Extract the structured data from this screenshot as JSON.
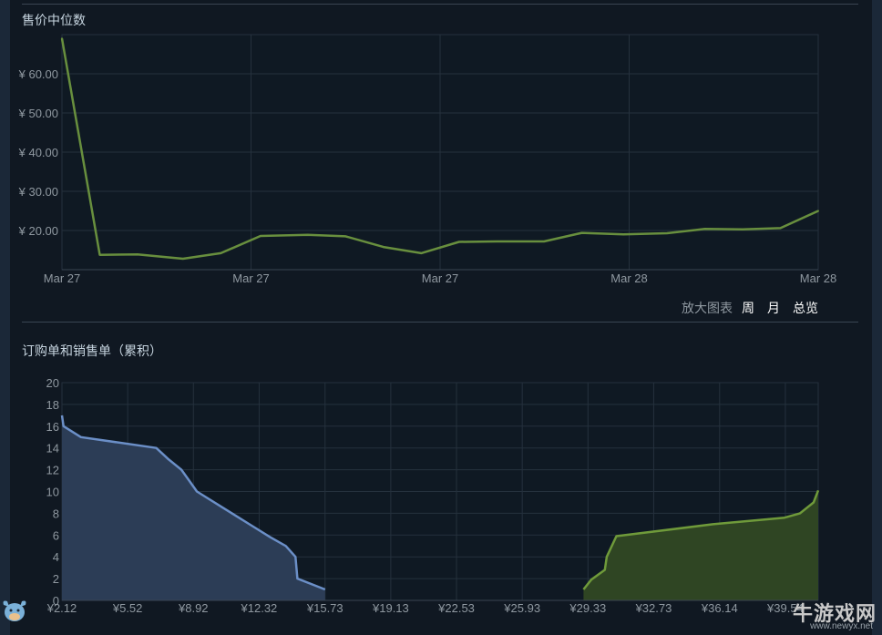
{
  "chart_data": [
    {
      "type": "line",
      "title": "售价中位数",
      "y_tick_labels": [
        "¥ 20.00",
        "¥ 30.00",
        "¥ 40.00",
        "¥ 50.00",
        "¥ 60.00"
      ],
      "y_ticks": [
        20,
        30,
        40,
        50,
        60
      ],
      "ylim": [
        10,
        70
      ],
      "x_tick_labels": [
        "Mar 27",
        "Mar 27",
        "Mar 27",
        "Mar 28",
        "Mar 28"
      ],
      "x_ticks": [
        0,
        1,
        2,
        3,
        4
      ],
      "xlim": [
        0,
        4
      ],
      "grid": true,
      "series": [
        {
          "color": "#688f3e",
          "points": [
            [
              0,
              69.0
            ],
            [
              0.2,
              13.8
            ],
            [
              0.4,
              13.9
            ],
            [
              0.64,
              12.8
            ],
            [
              0.84,
              14.2
            ],
            [
              1.05,
              18.6
            ],
            [
              1.3,
              18.9
            ],
            [
              1.5,
              18.5
            ],
            [
              1.7,
              15.8
            ],
            [
              1.9,
              14.2
            ],
            [
              2.1,
              17.1
            ],
            [
              2.3,
              17.2
            ],
            [
              2.55,
              17.2
            ],
            [
              2.75,
              19.4
            ],
            [
              2.97,
              19.0
            ],
            [
              3.2,
              19.3
            ],
            [
              3.4,
              20.4
            ],
            [
              3.6,
              20.3
            ],
            [
              3.8,
              20.6
            ],
            [
              4.0,
              25.0
            ]
          ]
        }
      ]
    },
    {
      "type": "area",
      "title": "订购单和销售单（累积）",
      "y_ticks": [
        0,
        2,
        4,
        6,
        8,
        10,
        12,
        14,
        16,
        18,
        20
      ],
      "ylim": [
        0,
        20
      ],
      "x_tick_labels": [
        "¥2.12",
        "¥5.52",
        "¥8.92",
        "¥12.32",
        "¥15.73",
        "¥19.13",
        "¥22.53",
        "¥25.93",
        "¥29.33",
        "¥32.73",
        "¥36.14",
        "¥39.54"
      ],
      "x_ticks": [
        2.12,
        5.52,
        8.92,
        12.32,
        15.73,
        19.13,
        22.53,
        25.93,
        29.33,
        32.73,
        36.14,
        39.54
      ],
      "xlim": [
        2.12,
        41.24
      ],
      "grid": true,
      "series": [
        {
          "color": "#6b8fc7",
          "fill": "#2c3d56",
          "points": [
            [
              2.12,
              17
            ],
            [
              2.2,
              16
            ],
            [
              3.1,
              15
            ],
            [
              7.0,
              14
            ],
            [
              7.6,
              13
            ],
            [
              8.3,
              12
            ],
            [
              8.7,
              11
            ],
            [
              9.1,
              10
            ],
            [
              11.9,
              6.9
            ],
            [
              12.9,
              5.8
            ],
            [
              13.7,
              5.0
            ],
            [
              14.2,
              4.0
            ],
            [
              14.3,
              2.0
            ],
            [
              15.73,
              1.0
            ]
          ]
        },
        {
          "color": "#6f9a3a",
          "fill": "#2f4523",
          "points": [
            [
              29.1,
              1.0
            ],
            [
              29.5,
              1.9
            ],
            [
              30.2,
              2.8
            ],
            [
              30.3,
              4.0
            ],
            [
              30.8,
              5.9
            ],
            [
              35.8,
              7.0
            ],
            [
              39.5,
              7.6
            ],
            [
              40.3,
              8.0
            ],
            [
              41.0,
              9.0
            ],
            [
              41.24,
              10.1
            ]
          ]
        }
      ]
    }
  ],
  "zoom": {
    "label": "放大图表",
    "buttons": [
      "周",
      "月",
      "总览"
    ]
  },
  "watermark": {
    "brand": "牛游戏网",
    "url": "www.newyx.net"
  }
}
